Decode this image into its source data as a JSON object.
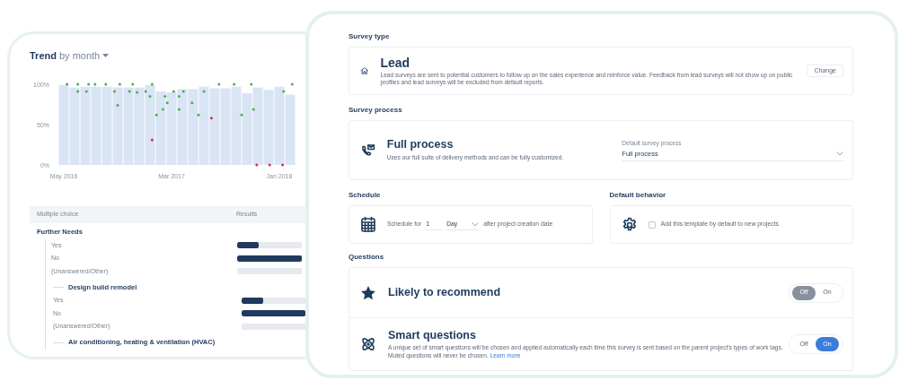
{
  "trend": {
    "title": "Trend",
    "period": "by month",
    "chart_data": {
      "type": "bar",
      "categories": [
        "May 2016",
        null,
        null,
        null,
        null,
        null,
        null,
        null,
        null,
        null,
        "Mar 2017",
        null,
        null,
        null,
        null,
        null,
        null,
        null,
        null,
        null,
        "Jan 2018",
        null
      ],
      "series": [
        {
          "color": "#d9e4f5",
          "values": [
            99,
            96,
            97,
            97,
            97,
            96,
            96,
            96,
            99,
            91,
            90,
            94,
            94,
            97,
            95,
            95,
            97,
            89,
            96,
            93,
            97,
            87
          ]
        }
      ],
      "ylim": [
        0,
        100
      ],
      "yticks": [
        {
          "value": 0,
          "label": "0%"
        },
        {
          "value": 50,
          "label": "50%"
        },
        {
          "value": 100,
          "label": "100%"
        }
      ]
    }
  },
  "results_table": {
    "columns": [
      "Multiple choice",
      "Results"
    ],
    "rows": [
      {
        "kind": "question",
        "label": "Further Needs",
        "children": [
          {
            "kind": "answer",
            "label": "Yes",
            "level": 0.33
          },
          {
            "kind": "answer",
            "label": "No",
            "level": 1
          },
          {
            "kind": "answer",
            "label": "(Unanswered/Other)",
            "level": 0
          },
          {
            "kind": "question",
            "label": "Design build remodel",
            "children": [
              {
                "kind": "answer",
                "label": "Yes",
                "level": 0.33
              },
              {
                "kind": "answer",
                "label": "No",
                "level": 1
              },
              {
                "kind": "answer",
                "label": "(Unanswered/Other)",
                "level": 0
              }
            ]
          },
          {
            "kind": "question",
            "label": "Air conditioning, heating & ventilation (HVAC)"
          }
        ]
      }
    ]
  },
  "survey_type": {
    "heading": "Survey type",
    "title": "Lead",
    "description": "Lead surveys are sent to potential customers to follow up on the sales experience and reinforce value. Feedback from lead surveys will not show up on public profiles and lead surveys will be excluded from default reports.",
    "button": "Change"
  },
  "survey_process": {
    "heading": "Survey process",
    "title": "Full process",
    "description": "Uses our full suite of delivery methods and can be fully customized.",
    "select": {
      "label": "Default survey process",
      "value": "Full process"
    }
  },
  "schedule": {
    "heading": "Schedule",
    "prefix": "Schedule for",
    "amount": "1",
    "unit": "Day",
    "suffix": "after project creation date"
  },
  "default_behavior": {
    "heading": "Default behavior",
    "checkbox": {
      "label": "Add this template by default to new projects",
      "checked": false
    }
  },
  "questions": {
    "heading": "Questions",
    "items": [
      {
        "title": "Likely to recommend",
        "off_label": "Off",
        "on_label": "On",
        "on": false
      },
      {
        "title": "Smart questions",
        "description": "A unique set of smart questions will be chosen and applied automatically each time this survey is sent based on the parent project's types of work tags. Muted questions will never be chosen.",
        "link": "Learn more",
        "off_label": "Off",
        "on_label": "On",
        "on": true
      }
    ]
  }
}
